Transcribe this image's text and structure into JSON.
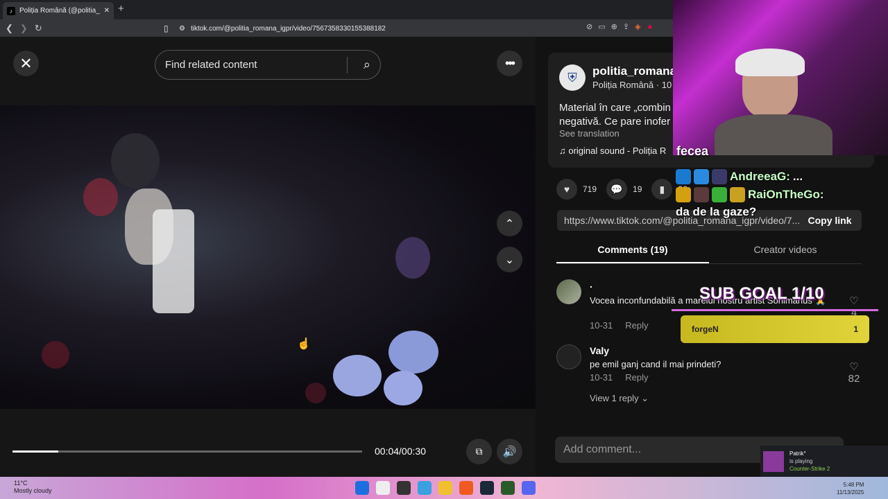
{
  "browser": {
    "tab_title": "Poliția Română (@politia_rom",
    "tab_close": "✕",
    "new_tab": "+",
    "url": "tiktok.com/@politia_romana_igpr/video/7567358330155388182"
  },
  "player": {
    "search_placeholder": "Find related content",
    "time": "00:04/00:30",
    "progress": 0.13
  },
  "post": {
    "username": "politia_romana",
    "nickname": "Poliția Română · 10",
    "description": "Material în care „combin negativă. Ce pare inofer",
    "see_translation": "See translation",
    "sound": "♫  original sound - Poliția R",
    "likes": "719",
    "comments": "19",
    "saves": "36",
    "link": "https://www.tiktok.com/@politia_romana_igpr/video/7...",
    "copy_link": "Copy link"
  },
  "tabs": {
    "comments": "Comments (19)",
    "creator": "Creator videos"
  },
  "comments": [
    {
      "name": ".",
      "text": "Vocea inconfundabilă a marelui nostru artist Sonimarius 🙏",
      "date": "10-31",
      "reply": "Reply",
      "likes": "4"
    },
    {
      "name": "Valy",
      "text": "pe emil ganj cand il mai prindeti?",
      "date": "10-31",
      "reply": "Reply",
      "likes": "82"
    }
  ],
  "view_reply": "View 1 reply ⌄",
  "add_comment": "Add comment...",
  "stream": {
    "chat1_user": "AndreeaG:",
    "chat1_msg": "...",
    "chat2_user": "RaiOnTheGo:",
    "chat2_msg": "da de la gaze?",
    "chat_top": "fecea",
    "sub_goal": "SUB GOAL 1/10",
    "goal_user": "forgeN",
    "goal_count": "1"
  },
  "taskbar": {
    "temp": "11°C",
    "weather": "Mostly cloudy",
    "time": "5:48 PM",
    "date": "11/13/2025"
  },
  "steam": {
    "name": "Patrik°",
    "status": "is playing",
    "game": "Counter-Strike 2"
  }
}
